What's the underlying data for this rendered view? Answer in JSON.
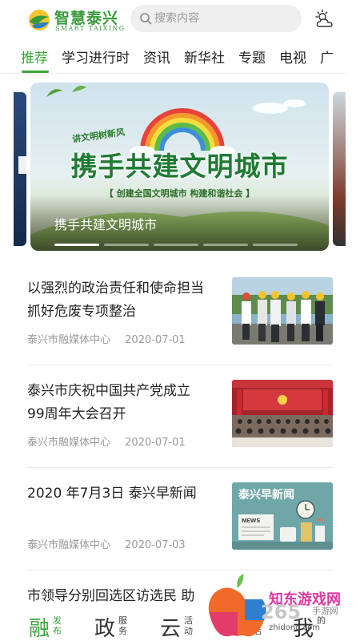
{
  "header": {
    "logo_cn": "智慧泰兴",
    "logo_en": "SMART TAIXING",
    "search_placeholder": "搜索内容",
    "weather_icon": "partly-cloudy-icon"
  },
  "tabs": [
    {
      "label": "推荐",
      "active": true
    },
    {
      "label": "学习进行时",
      "active": false
    },
    {
      "label": "资讯",
      "active": false
    },
    {
      "label": "新华社",
      "active": false
    },
    {
      "label": "专题",
      "active": false
    },
    {
      "label": "电视",
      "active": false
    },
    {
      "label": "广",
      "active": false
    }
  ],
  "carousel": {
    "kicker": "讲文明树新风",
    "headline": "携手共建文明城市",
    "subline": "【 创建全国文明城市   构建和谐社会 】",
    "caption": "携手共建文明城市",
    "slide_count": 5,
    "active_index": 0
  },
  "news": [
    {
      "title": "以强烈的政治责任和使命担当抓好危废专项整治",
      "source": "泰兴市融媒体中心",
      "date": "2020-07-01",
      "thumb": "inspection-photo"
    },
    {
      "title": "泰兴市庆祝中国共产党成立99周年大会召开",
      "source": "泰兴市融媒体中心",
      "date": "2020-07-01",
      "thumb": "meeting-hall-photo"
    },
    {
      "title": "2020 年7月3日 泰兴早新闻",
      "source": "泰兴市融媒体中心",
      "date": "2020-07-03",
      "thumb": "morning-news-illustration",
      "thumb_title": "泰兴早新闻",
      "thumb_paper": "NEWS"
    },
    {
      "title": "市领导分别回选区访选民  助",
      "source": "",
      "date": "",
      "thumb": ""
    }
  ],
  "bottom_nav": [
    {
      "big": "融",
      "small": "发布",
      "active": true
    },
    {
      "big": "政",
      "small": "服务",
      "active": false
    },
    {
      "big": "云",
      "small": "活动",
      "active": false
    },
    {
      "big": "",
      "small": "生活",
      "active": false
    },
    {
      "big": "我",
      "small": "的",
      "active": false
    }
  ],
  "watermark": {
    "text": "知东游戏网",
    "num": "265",
    "sub": "手游网",
    "url": "zhidong.com"
  },
  "colors": {
    "accent": "#3aa63a",
    "text": "#222222",
    "meta": "#999999"
  }
}
